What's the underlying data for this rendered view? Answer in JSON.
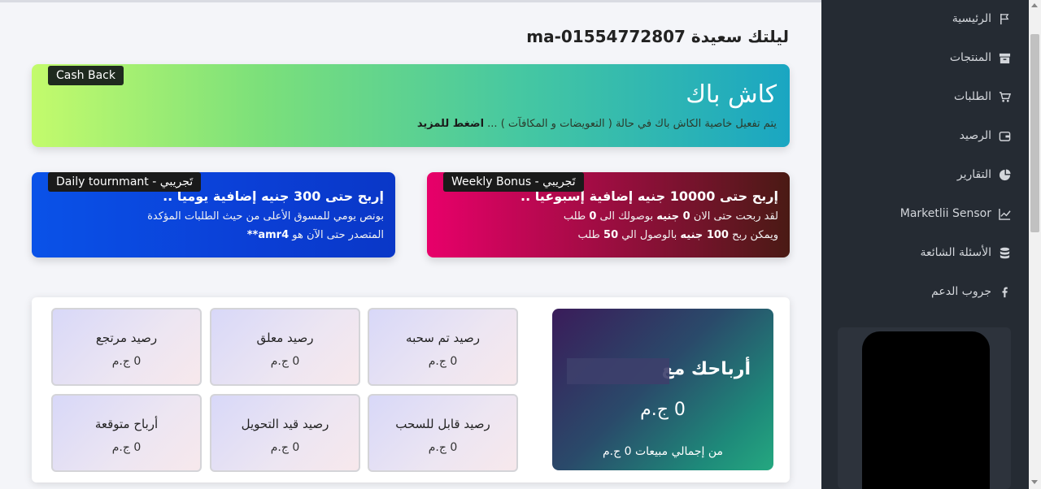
{
  "greeting": "ليلتك سعيدة ma-01554772807",
  "cashback": {
    "badge": "Cash Back",
    "title": "كاش باك",
    "desc": "يتم تفعيل خاصية الكاش باك في حالة ( التعويضات و المكافآت ) ... ",
    "more": "اضغط للمزيد"
  },
  "daily": {
    "badge": "Daily tournmant - تَجريبي",
    "title": "إربح حتى 300 جنيه إضافية يوميا ..",
    "line1": "بونص يومي للمسوق الأعلى من حيث الطلبات المؤكدة",
    "line2_prefix": "المتصدر حتى الآن هو ",
    "leader": "amr4**"
  },
  "weekly": {
    "badge": "Weekly Bonus - تَجريبي",
    "title": "إربح حتى 10000 جنيه إضافية إسبوعيا ..",
    "line1_a": "لقد ربحت حتى الان ",
    "line1_b": "0 جنيه",
    "line1_c": " بوصولك الى ",
    "line1_d": "0",
    "line1_e": " طلب",
    "line2_a": "ويمكن ربح ",
    "line2_b": "100 جنيه",
    "line2_c": " بالوصول الي ",
    "line2_d": "50",
    "line2_e": " طلب"
  },
  "earnings": {
    "title": "أرباحك مع",
    "amount": "0 ج.م",
    "subtitle": "من إجمالي مبيعات 0 ج.م"
  },
  "tiles": [
    {
      "label": "رصيد تم سحبه",
      "value": "0 ج.م"
    },
    {
      "label": "رصيد معلق",
      "value": "0 ج.م"
    },
    {
      "label": "رصيد مرتجع",
      "value": "0 ج.م"
    },
    {
      "label": "رصيد قابل للسحب",
      "value": "0 ج.م"
    },
    {
      "label": "رصيد قيد التحويل",
      "value": "0 ج.م"
    },
    {
      "label": "أرباح متوقعة",
      "value": "0 ج.م"
    }
  ],
  "nav": [
    {
      "label": "الرئيسية",
      "icon": "flag-icon"
    },
    {
      "label": "المنتجات",
      "icon": "archive-icon"
    },
    {
      "label": "الطلبات",
      "icon": "cart-icon"
    },
    {
      "label": "الرصيد",
      "icon": "wallet-icon"
    },
    {
      "label": "التقارير",
      "icon": "pie-chart-icon"
    },
    {
      "label": "Marketlii Sensor",
      "icon": "line-chart-icon"
    },
    {
      "label": "الأسئلة الشائعة",
      "icon": "database-icon"
    },
    {
      "label": "جروب الدعم",
      "icon": "facebook-icon"
    }
  ]
}
